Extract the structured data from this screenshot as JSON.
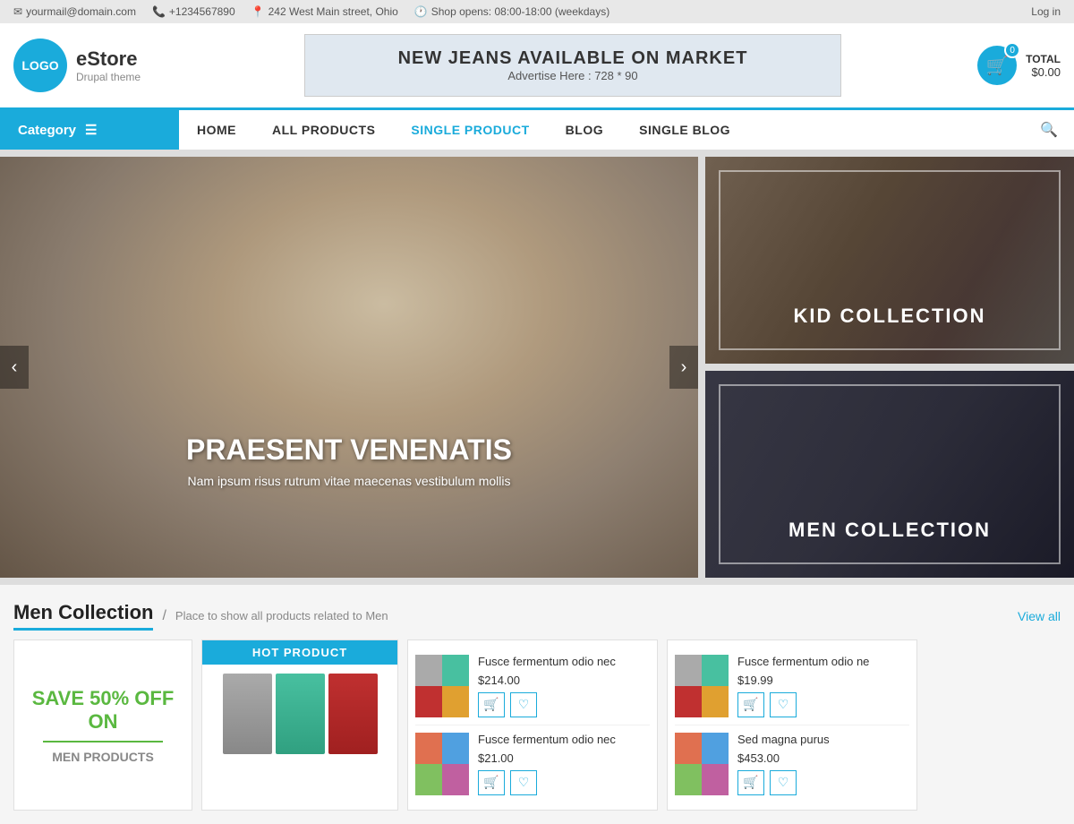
{
  "topbar": {
    "email": "yourmail@domain.com",
    "phone": "+1234567890",
    "address": "242 West Main street, Ohio",
    "hours": "Shop opens: 08:00-18:00 (weekdays)",
    "login": "Log in"
  },
  "header": {
    "logo_text": "LOGO",
    "brand": "eStore",
    "theme": "Drupal theme",
    "banner_title": "NEW JEANS AVAILABLE ON MARKET",
    "banner_subtitle": "Advertise Here : 728 * 90",
    "cart_count": "0",
    "cart_total_label": "TOTAL",
    "cart_total": "$0.00"
  },
  "nav": {
    "category_label": "Category",
    "links": [
      {
        "label": "HOME",
        "active": false
      },
      {
        "label": "ALL PRODUCTS",
        "active": false
      },
      {
        "label": "SINGLE PRODUCT",
        "active": true
      },
      {
        "label": "BLOG",
        "active": false
      },
      {
        "label": "SINGLE BLOG",
        "active": false
      }
    ]
  },
  "hero": {
    "title": "PRAESENT VENENATIS",
    "subtitle": "Nam ipsum risus rutrum vitae maecenas vestibulum mollis"
  },
  "hero_side": [
    {
      "label": "KID COLLECTION"
    },
    {
      "label": "MEN COLLECTION"
    }
  ],
  "men_section": {
    "title": "Men Collection",
    "subtitle": "Place to show all products related to Men",
    "view_all": "View all",
    "promo_save": "SAVE 50% OFF",
    "promo_on": "ON",
    "promo_products": "MEN PRODUCTS",
    "hot_label": "HOT PRODUCT",
    "products": [
      {
        "name": "Fusce fermentum odio nec",
        "price": "$214.00"
      },
      {
        "name": "Fusce fermentum odio nec",
        "price": "$21.00"
      }
    ],
    "products2": [
      {
        "name": "Fusce fermentum odio ne",
        "price": "$19.99"
      },
      {
        "name": "Sed magna purus",
        "price": "$453.00"
      }
    ]
  }
}
